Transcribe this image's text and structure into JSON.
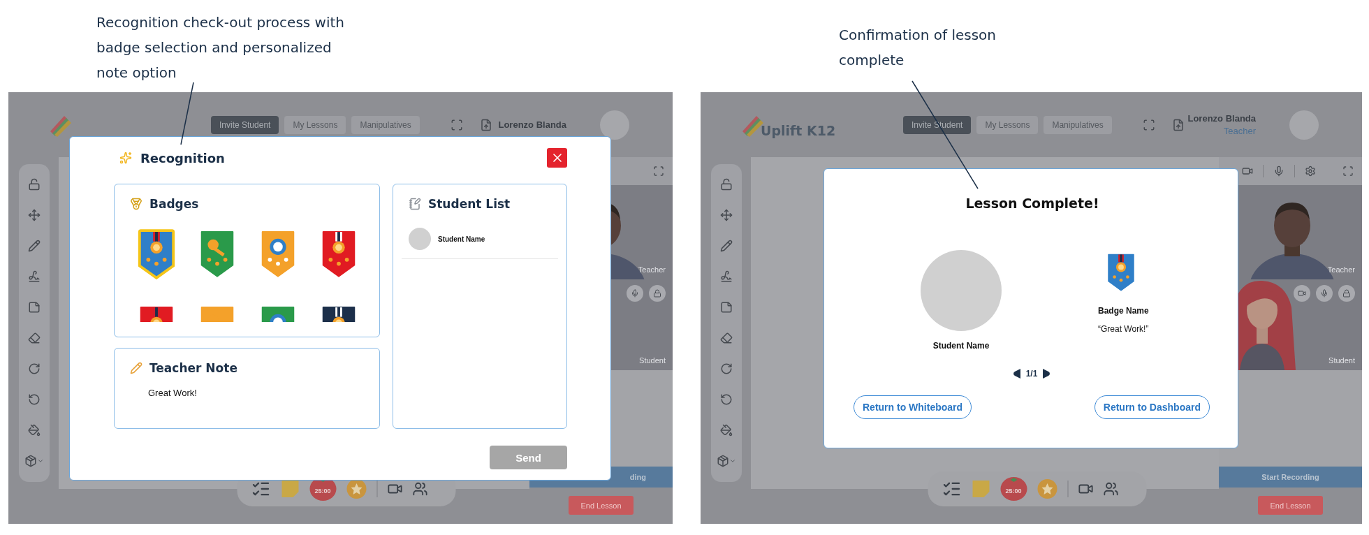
{
  "annotations": [
    {
      "text": "Recognition check-out process with badge selection and personalized note option"
    },
    {
      "text": "Confirmation of lesson complete"
    }
  ],
  "screens": [
    {
      "header": {
        "nav": [
          {
            "label": "Invite Student",
            "selected": true
          },
          {
            "label": "My Lessons",
            "selected": false
          },
          {
            "label": "Manipulatives",
            "selected": false
          }
        ],
        "user_name": "Lorenzo Blanda"
      },
      "video": {
        "teacher_label": "Teacher",
        "student_label": "Student",
        "recording_label": "ding",
        "end_label": "End Lesson"
      },
      "toolbar": {
        "timer": "25:00"
      },
      "modal": {
        "kind": "recognition",
        "title": "Recognition",
        "badges": {
          "title": "Badges",
          "items": [
            {
              "color": "#2f7fc8",
              "selected": true
            },
            {
              "color": "#2a9a4a",
              "selected": false
            },
            {
              "color": "#f4a12a",
              "selected": false
            },
            {
              "color": "#e11b22",
              "selected": false
            },
            {
              "color": "#e11b22",
              "selected": false
            },
            {
              "color": "#f4a12a",
              "selected": false
            },
            {
              "color": "#2a9a4a",
              "selected": false
            },
            {
              "color": "#1c2f4a",
              "selected": false
            }
          ]
        },
        "note": {
          "title": "Teacher Note",
          "value": "Great Work!"
        },
        "students": {
          "title": "Student List",
          "items": [
            {
              "name": "Student Name"
            }
          ]
        },
        "send": {
          "label": "Send",
          "disabled": true
        }
      }
    },
    {
      "header": {
        "logo_text": "Uplift K12",
        "nav": [
          {
            "label": "Invite Student",
            "selected": true
          },
          {
            "label": "My Lessons",
            "selected": false
          },
          {
            "label": "Manipulatives",
            "selected": false
          }
        ],
        "user_name": "Lorenzo Blanda",
        "user_role": "Teacher"
      },
      "video": {
        "teacher_label": "Teacher",
        "student_label": "Student",
        "recording_label": "Start Recording",
        "end_label": "End Lesson"
      },
      "toolbar": {
        "timer": "25:00"
      },
      "modal": {
        "kind": "lesson_complete",
        "title": "Lesson Complete!",
        "student_name": "Student Name",
        "badge_name": "Badge Name",
        "quote": "“Great Work!”",
        "pager": "1/1",
        "buttons": [
          {
            "label": "Return to Whiteboard"
          },
          {
            "label": "Return to Dashboard"
          }
        ]
      }
    }
  ]
}
